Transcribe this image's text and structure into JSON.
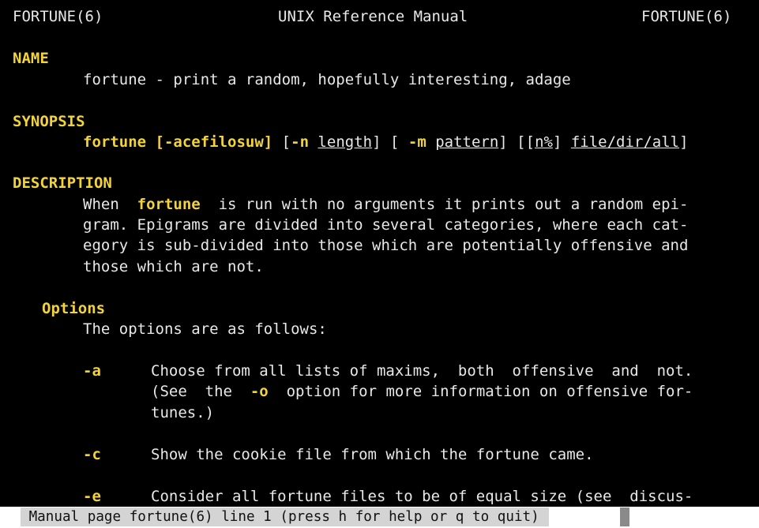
{
  "header": {
    "left": "FORTUNE(6)",
    "center": "UNIX Reference Manual",
    "right": "FORTUNE(6)"
  },
  "name": {
    "heading": "NAME",
    "text": "fortune - print a random, hopefully interesting, adage"
  },
  "synopsis": {
    "heading": "SYNOPSIS",
    "cmd": "fortune",
    "flags": " [-acefilosuw]",
    "open1": " [",
    "n_flag": "-n",
    "sp1": " ",
    "length": "length",
    "open2": "] [ ",
    "m_flag": "-m",
    "sp2": " ",
    "pattern": "pattern",
    "open3": "] [[",
    "npct": "n%",
    "close3": "] ",
    "file": "file/dir/all",
    "close4": "]"
  },
  "description": {
    "heading": "DESCRIPTION",
    "l1_pre": "When  ",
    "l1_cmd": "fortune",
    "l1_post": "  is run with no arguments it prints out a random epi-",
    "l2": "gram. Epigrams are divided into several categories, where each cat-",
    "l3": "egory is sub-divided into those which are potentially offensive and",
    "l4": "those which are not."
  },
  "options": {
    "heading": "Options",
    "intro": "The options are as follows:",
    "a_flag": "-a",
    "a_l1": "Choose from all lists of maxims,  both  offensive  and  not.",
    "a_l2_pre": "(See  the  ",
    "a_l2_flag": "-o",
    "a_l2_post": "  option for more information on offensive for-",
    "a_l3": "tunes.)",
    "c_flag": "-c",
    "c_l1": "Show the cookie file from which the fortune came.",
    "e_flag": "-e",
    "e_l1": "Consider all fortune files to be of equal size (see  discus-"
  },
  "status_bar": {
    "text": " Manual page fortune(6) line 1 (press h for help or q to quit)"
  },
  "colors": {
    "background": "#000000",
    "text": "#e8e8e8",
    "bold_highlight": "#f2d33a",
    "status_bar": "#d4d4d4"
  }
}
